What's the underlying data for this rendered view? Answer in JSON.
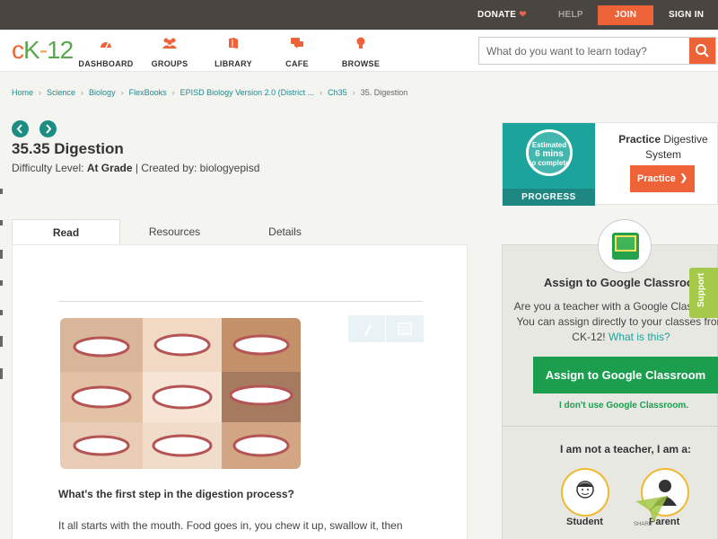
{
  "topbar": {
    "donate": "DONATE",
    "help": "HELP",
    "join": "JOIN",
    "signin": "SIGN IN"
  },
  "header": {
    "logo": {
      "c": "c",
      "k": "K",
      "dash": "-",
      "twelve": "12"
    },
    "nav": [
      {
        "label": "DASHBOARD",
        "icon": "dashboard-icon"
      },
      {
        "label": "GROUPS",
        "icon": "groups-icon"
      },
      {
        "label": "LIBRARY",
        "icon": "library-icon"
      },
      {
        "label": "CAFE",
        "icon": "cafe-icon"
      },
      {
        "label": "BROWSE",
        "icon": "browse-icon"
      }
    ],
    "search_placeholder": "What do you want to learn today?"
  },
  "breadcrumb": [
    "Home",
    "Science",
    "Biology",
    "FlexBooks",
    "EPISD Biology Version 2.0 (District ...",
    "Ch35",
    "35. Digestion"
  ],
  "page": {
    "title": "35.35 Digestion",
    "difficulty_prefix": "Difficulty Level: ",
    "difficulty_value": "At Grade",
    "created_by": " | Created by: biologyepisd"
  },
  "tabs": [
    "Read",
    "Resources",
    "Details"
  ],
  "article": {
    "question": "What's the first step in the digestion process?",
    "body": "It all starts with the mouth. Food goes in, you chew it up, swallow it, then"
  },
  "practice": {
    "estimated_line1": "Estimated",
    "estimated_line2": "6 mins",
    "estimated_line3": "to complete",
    "progress_label": "PROGRESS",
    "title_bold": "Practice",
    "title_rest": " Digestive System",
    "button": "Practice"
  },
  "assign": {
    "title": "Assign to Google Classroom",
    "desc": "Are you a teacher with a Google Classroom? You can assign directly to your classes from CK-12!",
    "desc_link": "What is this?",
    "button": "Assign to Google Classroom",
    "dont_use": "I don't use Google Classroom.",
    "role_title": "I am not a teacher, I am a:",
    "roles": [
      "Student",
      "Parent"
    ]
  },
  "support": "Support",
  "share": "SHARE",
  "colors": {
    "accent": "#ee6237",
    "teal": "#1ca49c",
    "green": "#1b9e4e",
    "topbar": "#4a4540"
  }
}
